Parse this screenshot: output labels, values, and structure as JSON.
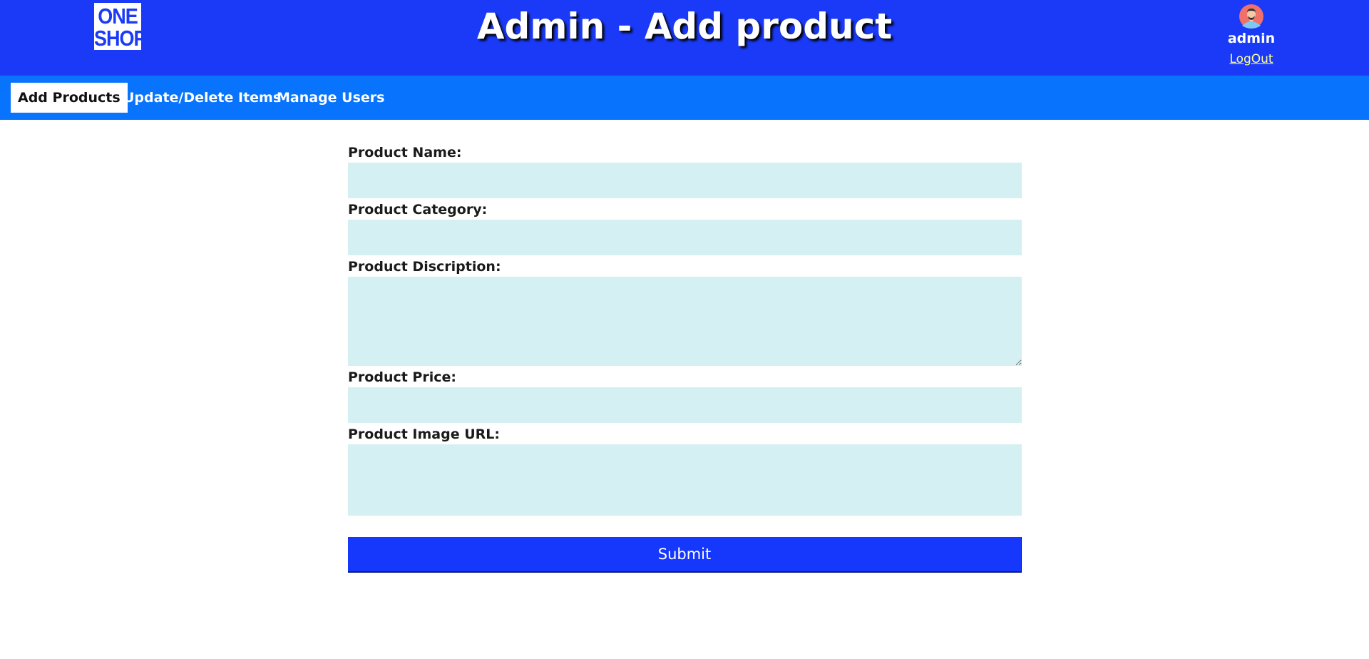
{
  "header": {
    "logo_lines": [
      "ONE",
      "SHOP"
    ],
    "title": "Admin - Add product",
    "user": {
      "avatar_icon": "user-avatar-icon",
      "name": "admin",
      "logout_label": "LogOut"
    }
  },
  "nav": {
    "items": [
      {
        "label": "Add Products",
        "active": true
      },
      {
        "label": "Update/Delete Items",
        "active": false
      },
      {
        "label": "Manage Users",
        "active": false
      }
    ]
  },
  "form": {
    "product_name_label": "Product Name:",
    "product_name_value": "",
    "product_category_label": "Product Category:",
    "product_category_value": "",
    "product_description_label": "Product Discription:",
    "product_description_value": "",
    "product_price_label": "Product Price:",
    "product_price_value": "",
    "product_image_url_label": "Product Image URL:",
    "product_image_url_value": "",
    "submit_label": "Submit"
  },
  "colors": {
    "header_bg": "#1a3af8",
    "nav_bg": "#0874fe",
    "input_bg": "#d4f0f3",
    "submit_bg": "#1538fc",
    "logout_link": "#ffff99"
  }
}
